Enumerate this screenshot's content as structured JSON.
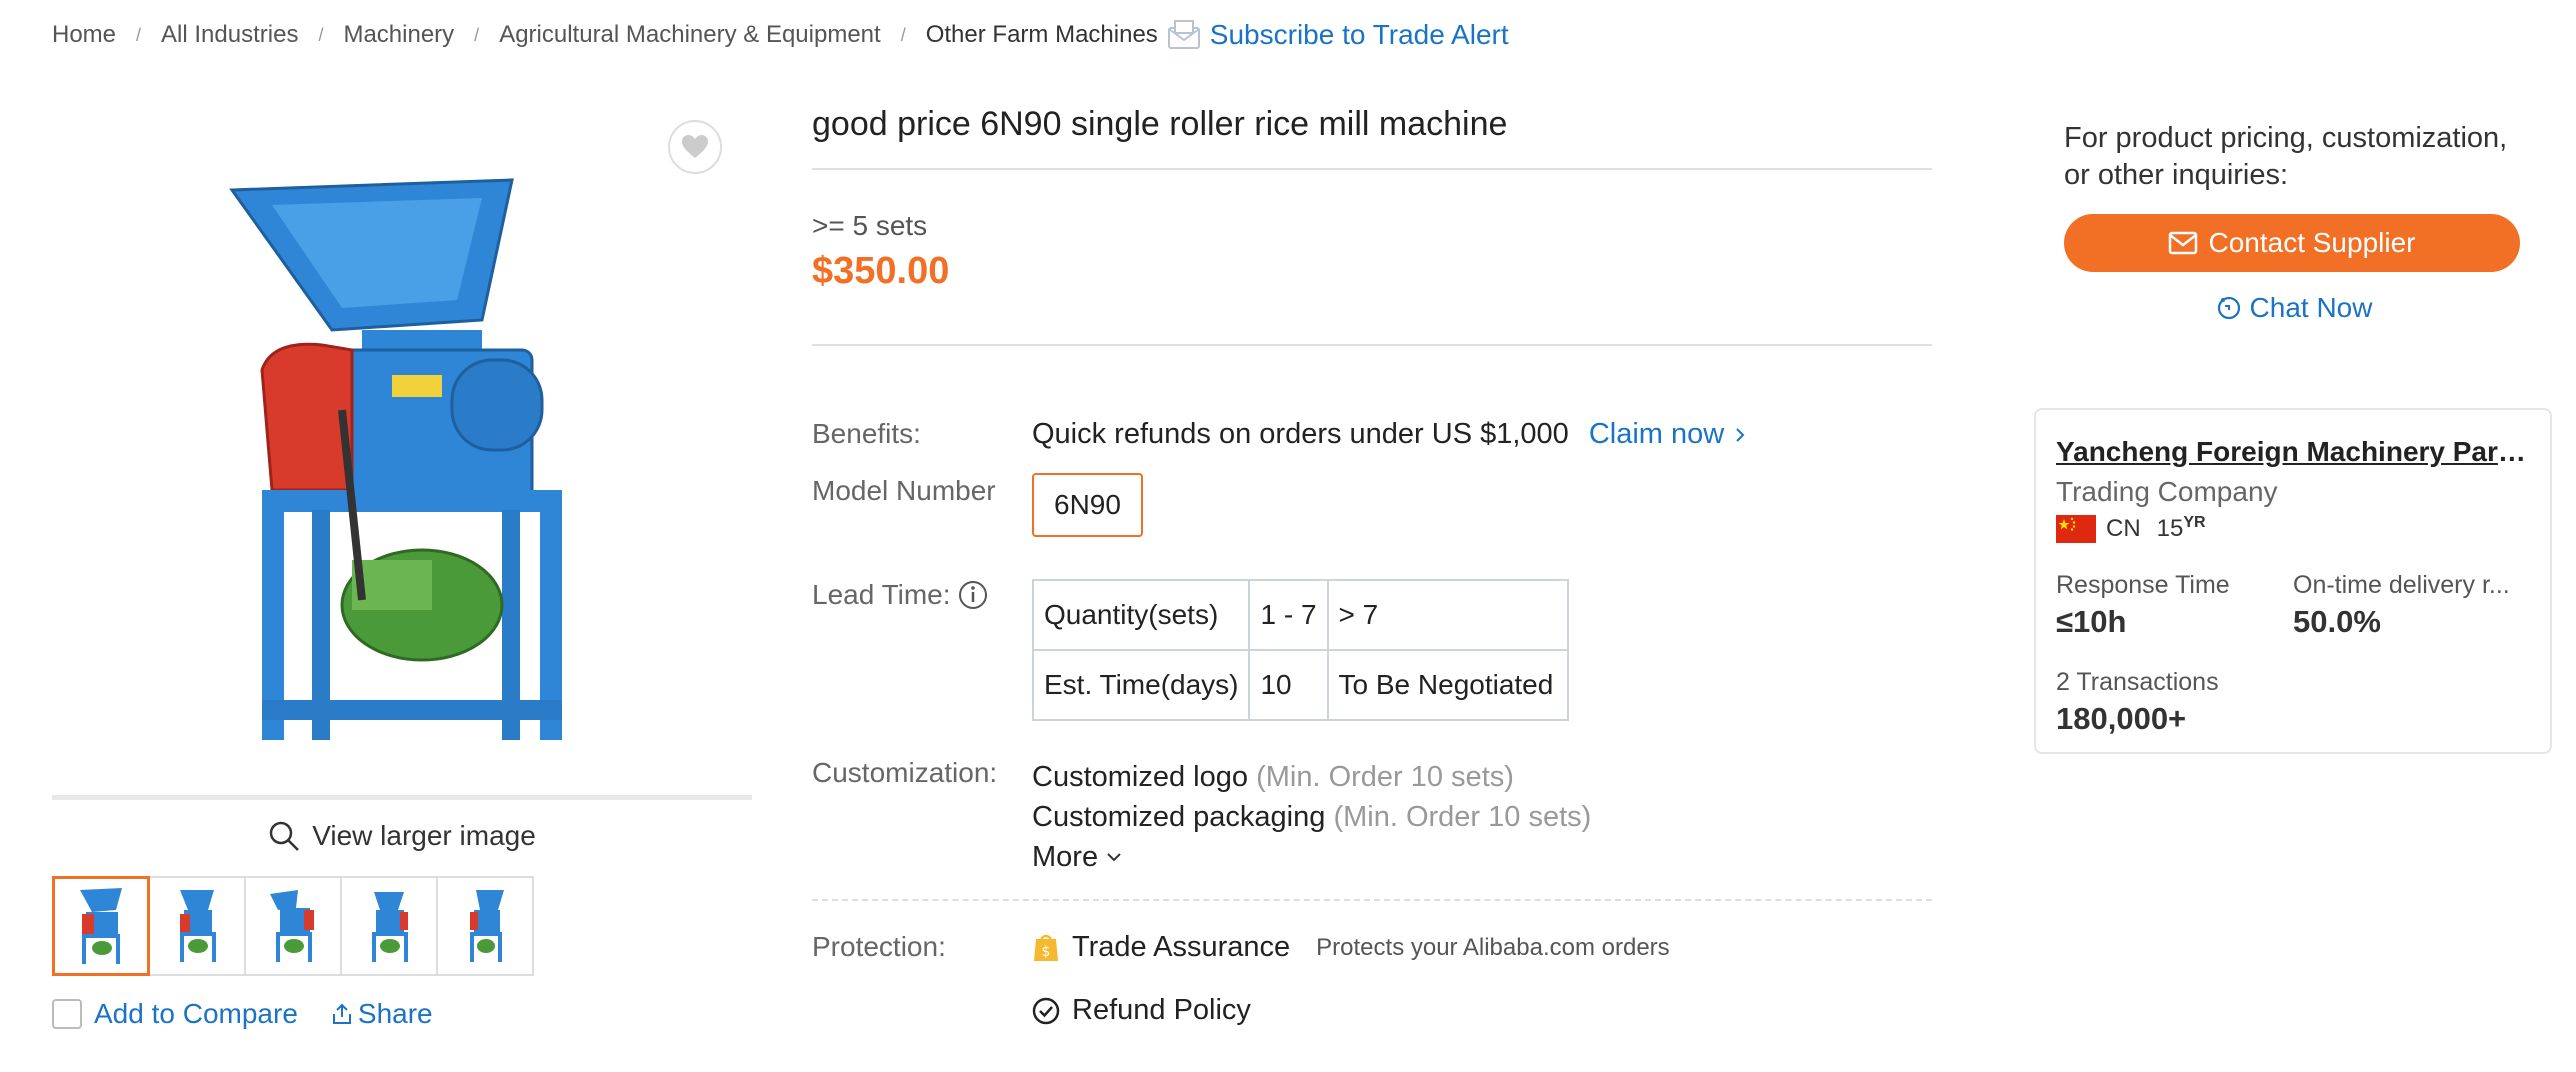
{
  "breadcrumb": {
    "items": [
      "Home",
      "All Industries",
      "Machinery",
      "Agricultural Machinery & Equipment",
      "Other Farm Machines"
    ],
    "separator": "/",
    "subscribe_label": "Subscribe to Trade Alert"
  },
  "gallery": {
    "view_larger_label": "View larger image",
    "thumbnail_count": 5,
    "compare_label": "Add to Compare",
    "share_label": "Share"
  },
  "product": {
    "title": "good price 6N90 single roller rice mill machine",
    "price_qty": ">= 5 sets",
    "price": "$350.00"
  },
  "benefits": {
    "label": "Benefits:",
    "text": "Quick refunds on orders under US $1,000",
    "claim_label": "Claim now"
  },
  "model": {
    "label": "Model Number",
    "value": "6N90"
  },
  "lead_time": {
    "label": "Lead Time:",
    "rows": [
      [
        "Quantity(sets)",
        "1 - 7",
        "> 7"
      ],
      [
        "Est. Time(days)",
        "10",
        "To Be Negotiated"
      ]
    ]
  },
  "customization": {
    "label": "Customization:",
    "items": [
      {
        "name": "Customized logo",
        "note": "(Min. Order 10 sets)"
      },
      {
        "name": "Customized packaging",
        "note": "(Min. Order 10 sets)"
      }
    ],
    "more_label": "More"
  },
  "protection": {
    "label": "Protection:",
    "trade_assurance": "Trade Assurance",
    "trade_note": "Protects your Alibaba.com orders",
    "refund": "Refund Policy"
  },
  "supplier": {
    "inquiry_text": "For product pricing, customization, or other inquiries:",
    "contact_label": "Contact Supplier",
    "chat_label": "Chat Now",
    "company": "Yancheng Foreign Machinery Parts ...",
    "type": "Trading Company",
    "country": "CN",
    "years": "15",
    "years_unit": "YR",
    "stats": [
      {
        "label": "Response Time",
        "value": "≤10h"
      },
      {
        "label": "On-time delivery r...",
        "value": "50.0%"
      }
    ],
    "transactions_label": "2 Transactions",
    "transactions_value": "180,000+"
  },
  "colors": {
    "accent": "#f26f26",
    "link": "#1a73c7",
    "machine_blue": "#2f86d6",
    "machine_red": "#d83a2c",
    "motor_green": "#4a9a3a"
  }
}
